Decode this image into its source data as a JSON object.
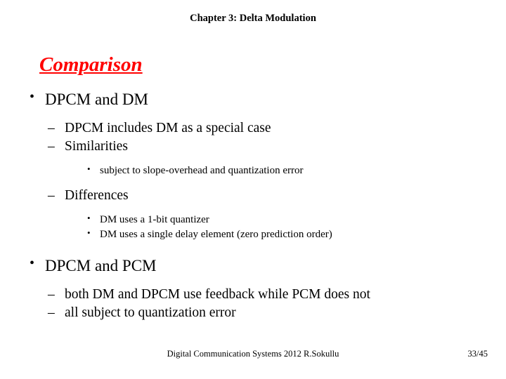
{
  "header": {
    "chapter": "Chapter 3: Delta Modulation"
  },
  "title": "Comparison",
  "colors": {
    "title": "#ff0000",
    "text": "#000000",
    "background": "#ffffff"
  },
  "bullets": {
    "disc": "•",
    "dash": "–"
  },
  "content": [
    {
      "level": 1,
      "text": "DPCM and DM"
    },
    {
      "level": 2,
      "text": "DPCM includes DM as a special case"
    },
    {
      "level": 2,
      "text": "Similarities"
    },
    {
      "level": 3,
      "text": "subject to slope-overhead and quantization error"
    },
    {
      "level": 2,
      "text": "Differences"
    },
    {
      "level": 3,
      "text": "DM uses a 1-bit quantizer"
    },
    {
      "level": 3,
      "text": "DM uses a single delay element (zero prediction order)"
    },
    {
      "level": 1,
      "text": "DPCM and PCM"
    },
    {
      "level": 2,
      "text": "both DM and DPCM use feedback while PCM does not"
    },
    {
      "level": 2,
      "text": "all subject to quantization error"
    }
  ],
  "footer": {
    "center": "Digital Communication Systems 2012 R.Sokullu",
    "page": "33/45"
  }
}
